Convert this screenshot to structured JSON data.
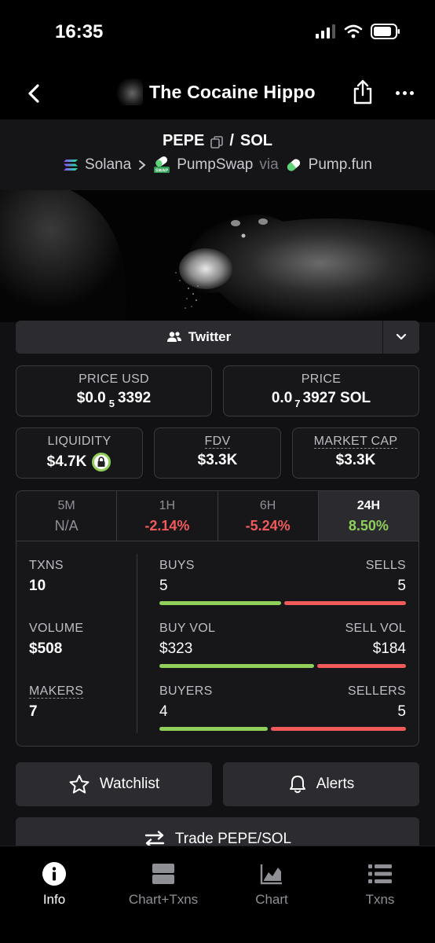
{
  "status": {
    "time": "16:35"
  },
  "nav": {
    "title": "The Cocaine Hippo"
  },
  "pair": {
    "base": "PEPE",
    "separator": "/",
    "quote": "SOL",
    "chain": "Solana",
    "dex": "PumpSwap",
    "via": "via",
    "launchpad": "Pump.fun"
  },
  "links": {
    "twitter": "Twitter"
  },
  "price": {
    "usd_label": "PRICE USD",
    "usd_prefix": "$0.0",
    "usd_sub": "5",
    "usd_suffix": "3392",
    "native_label": "PRICE",
    "native_prefix": "0.0",
    "native_sub": "7",
    "native_suffix": "3927 SOL"
  },
  "metrics": {
    "liquidity_label": "LIQUIDITY",
    "liquidity_value": "$4.7K",
    "fdv_label": "FDV",
    "fdv_value": "$3.3K",
    "mcap_label": "MARKET CAP",
    "mcap_value": "$3.3K"
  },
  "timeframes": [
    {
      "label": "5M",
      "value": "N/A"
    },
    {
      "label": "1H",
      "value": "-2.14%"
    },
    {
      "label": "6H",
      "value": "-5.24%"
    },
    {
      "label": "24H",
      "value": "8.50%"
    }
  ],
  "stats": {
    "txns_label": "TXNS",
    "txns_value": "10",
    "volume_label": "VOLUME",
    "volume_value": "$508",
    "makers_label": "MAKERS",
    "makers_value": "7",
    "buys_label": "BUYS",
    "buys_value": "5",
    "sells_label": "SELLS",
    "sells_value": "5",
    "buy_vol_label": "BUY VOL",
    "buy_vol_value": "$323",
    "sell_vol_label": "SELL VOL",
    "sell_vol_value": "$184",
    "buyers_label": "BUYERS",
    "buyers_value": "4",
    "sellers_label": "SELLERS",
    "sellers_value": "5",
    "buys_share": 0.5,
    "buy_vol_share": 0.637,
    "buyers_share": 0.444
  },
  "actions": {
    "watchlist": "Watchlist",
    "alerts": "Alerts",
    "trade": "Trade PEPE/SOL"
  },
  "tabs": [
    {
      "label": "Info",
      "icon": "info-icon"
    },
    {
      "label": "Chart+Txns",
      "icon": "split-icon"
    },
    {
      "label": "Chart",
      "icon": "chart-icon"
    },
    {
      "label": "Txns",
      "icon": "list-icon"
    }
  ],
  "colors": {
    "positive": "#8fcf5a",
    "negative": "#f05a5a",
    "background": "#111114"
  }
}
